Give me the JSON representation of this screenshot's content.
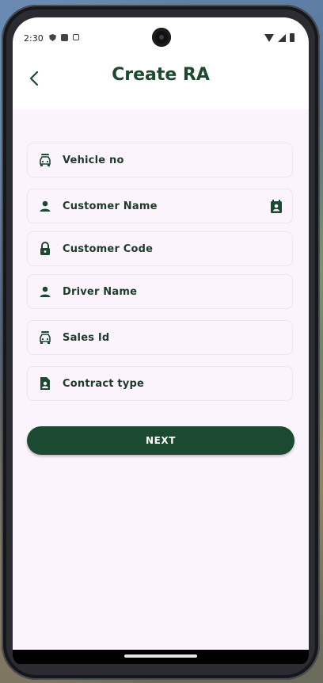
{
  "status_bar": {
    "time": "2:30",
    "left_icons": [
      "shield-icon",
      "sim-icon",
      "a-icon"
    ],
    "right_icons": [
      "wifi-icon",
      "signal-icon",
      "battery-icon"
    ]
  },
  "header": {
    "back_icon": "chevron-left-icon",
    "title": "Create RA"
  },
  "form": {
    "fields": [
      {
        "label": "Vehicle no",
        "icon": "vehicle-icon"
      },
      {
        "label": "Customer Name",
        "icon": "person-icon",
        "trailing_icon": "contact-card-icon"
      },
      {
        "label": "Customer Code",
        "icon": "lock-icon"
      },
      {
        "label": "Driver Name",
        "icon": "person-icon"
      },
      {
        "label": "Sales Id",
        "icon": "vehicle-icon"
      },
      {
        "label": "Contract type",
        "icon": "document-person-icon"
      }
    ],
    "next_label": "NEXT"
  },
  "colors": {
    "primary": "#1b4a30",
    "background": "#fbf4fc",
    "label_text": "#1e3a2a"
  }
}
